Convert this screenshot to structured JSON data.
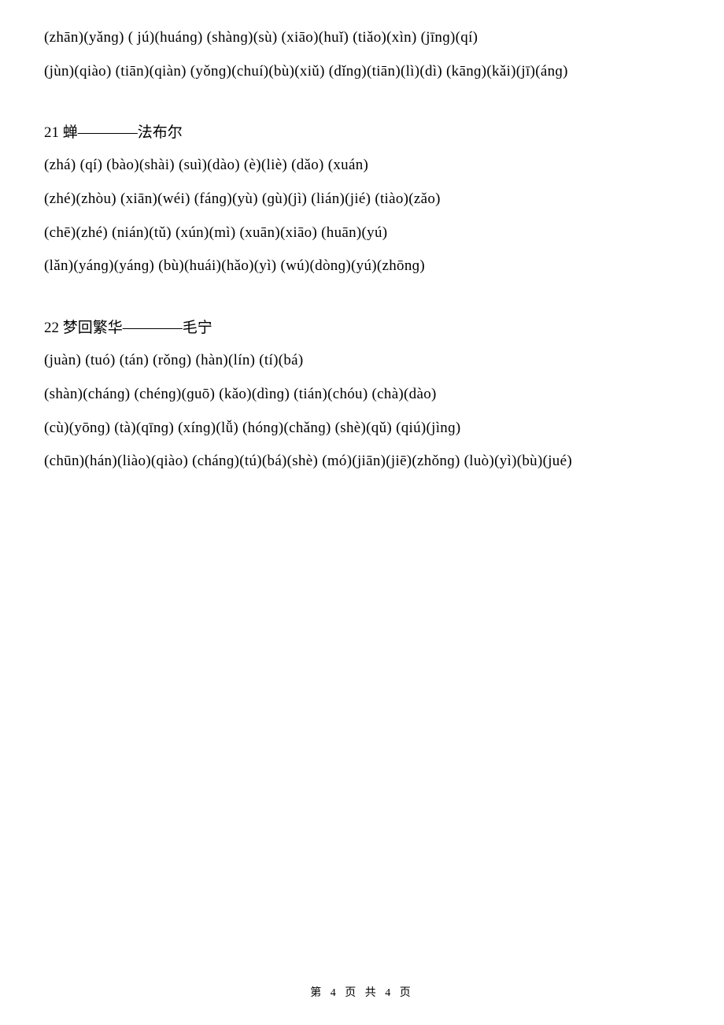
{
  "blocks": {
    "top": {
      "line1": "(zhān)(yǎnɡ)    ( jú)(huánɡ)    (shànɡ)(sù)    (xiāo)(huǐ)    (tiǎo)(xìn) (jīnɡ)(qí)",
      "line2": "(jùn)(qiào) (tiān)(qiàn)    (yǒnɡ)(chuí)(bù)(xiǔ)    (dǐnɡ)(tiān)(lì)(dì)    (kānɡ)(kǎi)(jī)(ánɡ)"
    },
    "section21": {
      "heading": "21 蝉————法布尔",
      "line1": "(zhá)      (qí)      (bào)(shài)      (suì)(dào)    (è)(liè)    (dǎo) (xuán)",
      "line2": "(zhé)(zhòu)      (xiān)(wéi)    (fánɡ)(yù)    (ɡù)(jì)    (lián)(jié) (tiào)(zǎo)",
      "line3": "(chē)(zhé)    (nián)(tǔ)    (xún)(mì)    (xuān)(xiāo)    (huān)(yú)",
      "line4": "(lǎn)(yánɡ)(yánɡ)      (bù)(huái)(hǎo)(yì) (wú)(dònɡ)(yú)(zhōnɡ)"
    },
    "section22": {
      "heading": "22 梦回繁华————毛宁",
      "line1": "(juàn)    (tuó)    (tán)    (rǒnɡ)    (hàn)(lín)    (tí)(bá)",
      "line2": "(shàn)(chánɡ)    (chénɡ)(ɡuō)    (kǎo)(dìnɡ)    (tián)(chóu)    (chà)(dào)",
      "line3": "(cù)(yōnɡ)    (tà)(qīnɡ)      (xínɡ)(lǚ)    (hónɡ)(chǎnɡ)    (shè)(qǔ)    (qiú)(jìnɡ)",
      "line4": "(chūn)(hán)(liào)(qiào) (chánɡ)(tú)(bá)(shè)    (mó)(jiān)(jiē)(zhǒnɡ)    (luò)(yì)(bù)(jué)"
    }
  },
  "footer": "第 4 页 共 4 页"
}
